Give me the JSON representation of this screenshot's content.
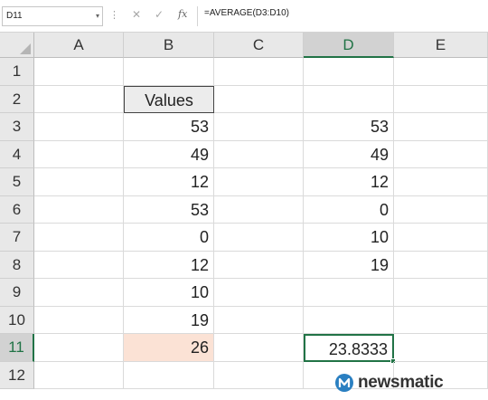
{
  "formula_bar": {
    "name_box": "D11",
    "cancel_icon": "✕",
    "enter_icon": "✓",
    "function_icon": "fx",
    "formula": "=AVERAGE(D3:D10)"
  },
  "columns": [
    "A",
    "B",
    "C",
    "D",
    "E"
  ],
  "rows": [
    "1",
    "2",
    "3",
    "4",
    "5",
    "6",
    "7",
    "8",
    "9",
    "10",
    "11",
    "12"
  ],
  "cells": {
    "B2": "Values",
    "B3": "53",
    "B4": "49",
    "B5": "12",
    "B6": "53",
    "B7": "0",
    "B8": "12",
    "B9": "10",
    "B10": "19",
    "B11": "26",
    "D3": "53",
    "D4": "49",
    "D5": "12",
    "D6": "0",
    "D7": "10",
    "D8": "19",
    "D11": "23.8333"
  },
  "selection": {
    "active_cell": "D11",
    "active_column": "D",
    "active_row": "11"
  },
  "colors": {
    "excel_green": "#217346",
    "highlight_fill": "#fbe2d5",
    "header_fill": "#ececec"
  },
  "watermark": {
    "text": "newsmatic",
    "logo": "newsmatic-logo"
  }
}
